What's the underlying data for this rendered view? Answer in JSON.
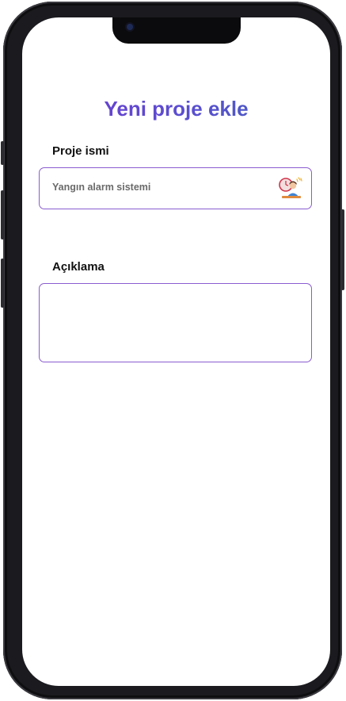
{
  "page": {
    "title": "Yeni proje ekle"
  },
  "form": {
    "project_name": {
      "label": "Proje ismi",
      "value": "Yangın alarm sistemi",
      "icon": "worker-avatar-icon"
    },
    "description": {
      "label": "Açıklama",
      "value": ""
    }
  },
  "colors": {
    "accent": "#8a5cd0",
    "title_gradient_start": "#6f3ad0",
    "title_gradient_end": "#3f63b8"
  }
}
